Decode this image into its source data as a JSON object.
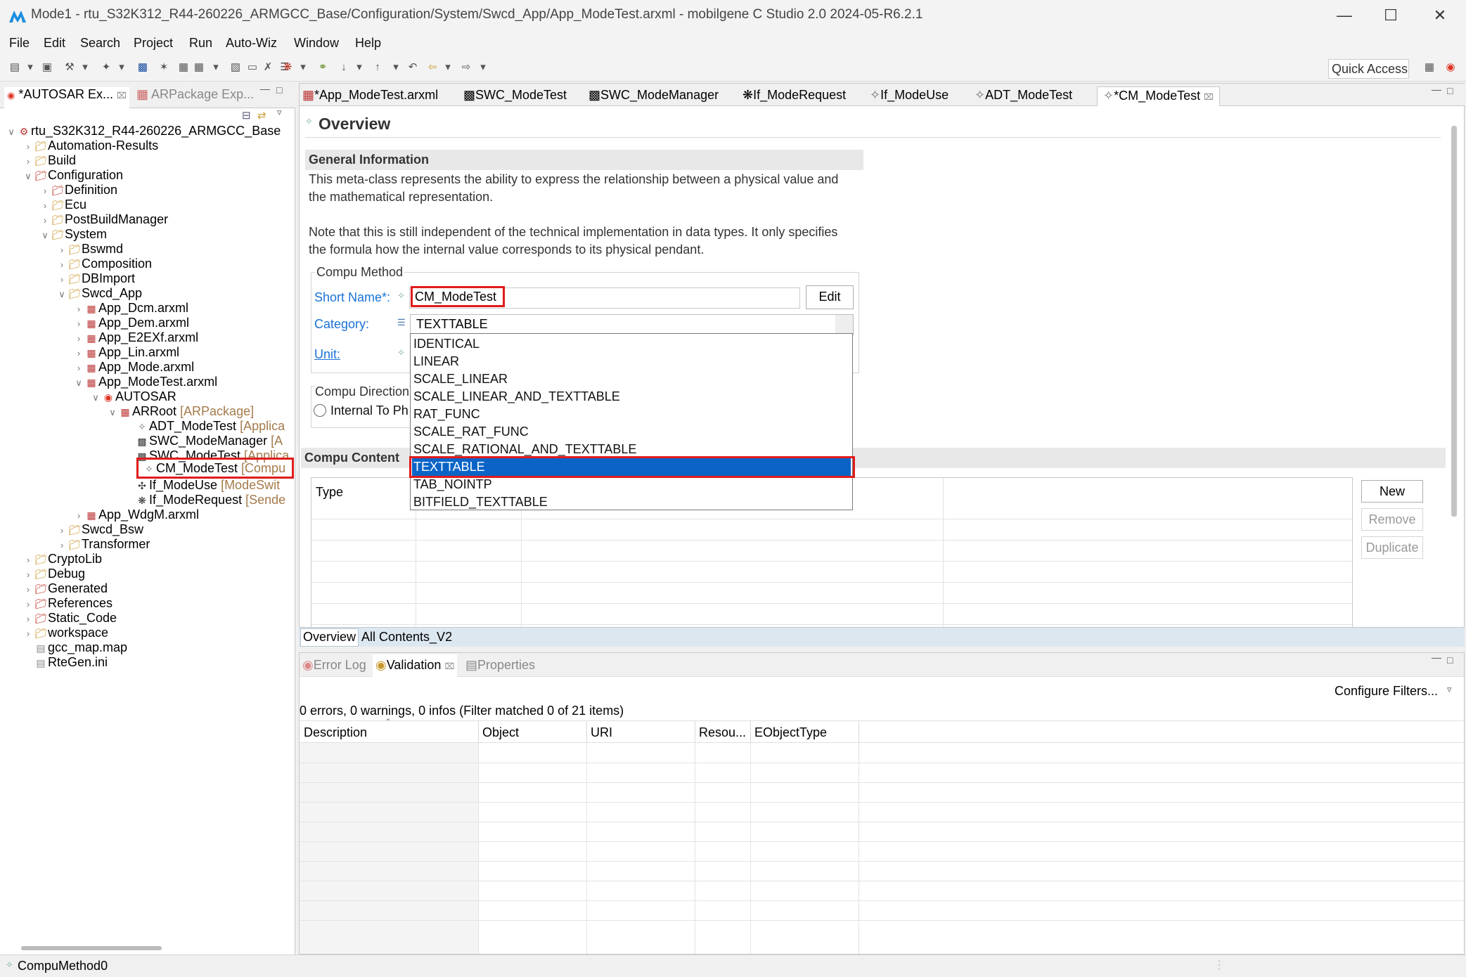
{
  "window": {
    "title": "Mode1 - rtu_S32K312_R44-260226_ARMGCC_Base/Configuration/System/Swcd_App/App_ModeTest.arxml - mobilgene C Studio 2.0 2024-05-R6.2.1"
  },
  "menu": [
    "File",
    "Edit",
    "Search",
    "Project",
    "Run",
    "Auto-Wiz",
    "Window",
    "Help"
  ],
  "toolbar": {
    "quick_access": "Quick Access"
  },
  "left_tabs": [
    "*AUTOSAR Ex...",
    "ARPackage Exp..."
  ],
  "tree": [
    {
      "label": "rtu_S32K312_R44-260226_ARMGCC_Base",
      "suffix": ""
    },
    {
      "label": "Automation-Results",
      "suffix": ""
    },
    {
      "label": "Build",
      "suffix": ""
    },
    {
      "label": "Configuration",
      "suffix": ""
    },
    {
      "label": "Definition",
      "suffix": ""
    },
    {
      "label": "Ecu",
      "suffix": ""
    },
    {
      "label": "PostBuildManager",
      "suffix": ""
    },
    {
      "label": "System",
      "suffix": ""
    },
    {
      "label": "Bswmd",
      "suffix": ""
    },
    {
      "label": "Composition",
      "suffix": ""
    },
    {
      "label": "DBImport",
      "suffix": ""
    },
    {
      "label": "Swcd_App",
      "suffix": ""
    },
    {
      "label": "App_Dcm.arxml",
      "suffix": ""
    },
    {
      "label": "App_Dem.arxml",
      "suffix": ""
    },
    {
      "label": "App_E2EXf.arxml",
      "suffix": ""
    },
    {
      "label": "App_Lin.arxml",
      "suffix": ""
    },
    {
      "label": "App_Mode.arxml",
      "suffix": ""
    },
    {
      "label": "App_ModeTest.arxml",
      "suffix": ""
    },
    {
      "label": "AUTOSAR",
      "suffix": ""
    },
    {
      "label": "ARRoot",
      "suffix": " [ARPackage]"
    },
    {
      "label": "ADT_ModeTest",
      "suffix": " [Applica"
    },
    {
      "label": "SWC_ModeManager",
      "suffix": " [A"
    },
    {
      "label": "SWC_ModeTest",
      "suffix": " [Applica"
    },
    {
      "label": "CM_ModeTest",
      "suffix": " [Compu"
    },
    {
      "label": "If_ModeUse",
      "suffix": " [ModeSwit"
    },
    {
      "label": "If_ModeRequest",
      "suffix": " [Sende"
    },
    {
      "label": "App_WdgM.arxml",
      "suffix": ""
    },
    {
      "label": "Swcd_Bsw",
      "suffix": ""
    },
    {
      "label": "Transformer",
      "suffix": ""
    },
    {
      "label": "CryptoLib",
      "suffix": ""
    },
    {
      "label": "Debug",
      "suffix": ""
    },
    {
      "label": "Generated",
      "suffix": ""
    },
    {
      "label": "References",
      "suffix": ""
    },
    {
      "label": "Static_Code",
      "suffix": ""
    },
    {
      "label": "workspace",
      "suffix": ""
    },
    {
      "label": "gcc_map.map",
      "suffix": ""
    },
    {
      "label": "RteGen.ini",
      "suffix": ""
    }
  ],
  "editor_tabs": [
    "*App_ModeTest.arxml",
    "SWC_ModeTest",
    "SWC_ModeManager",
    "If_ModeRequest",
    "If_ModeUse",
    "ADT_ModeTest",
    "*CM_ModeTest"
  ],
  "overview": {
    "title": "Overview",
    "general_header": "General Information",
    "desc1_line1": "This meta-class represents the ability to express the relationship between a physical value and",
    "desc1_line2": "the mathematical representation.",
    "desc2_line1": "Note that this is still independent of the technical implementation in data types. It only specifies",
    "desc2_line2": "the formula how the internal value corresponds to its physical pendant.",
    "compu_method_group": "Compu Method",
    "short_name_label": "Short Name*:",
    "short_name_value": "CM_ModeTest",
    "edit_button": "Edit",
    "category_label": "Category:",
    "category_value": "TEXTTABLE",
    "unit_label": "Unit:",
    "compu_direction_group": "Compu Direction",
    "direction_option": "Internal To Ph",
    "compu_content_header": "Compu Content",
    "type_column": "Type",
    "new_button": "New",
    "remove_button": "Remove",
    "duplicate_button": "Duplicate"
  },
  "category_options": [
    "IDENTICAL",
    "LINEAR",
    "SCALE_LINEAR",
    "SCALE_LINEAR_AND_TEXTTABLE",
    "RAT_FUNC",
    "SCALE_RAT_FUNC",
    "SCALE_RATIONAL_AND_TEXTTABLE",
    "TEXTTABLE",
    "TAB_NOINTP",
    "BITFIELD_TEXTTABLE"
  ],
  "selected_option_index": 7,
  "editor_bottom_tabs": [
    "Overview",
    "All Contents_V2"
  ],
  "bottom_panel": {
    "tabs": [
      "Error Log",
      "Validation",
      "Properties"
    ],
    "configure_filters": "Configure Filters...",
    "summary": "0 errors, 0 warnings, 0 infos (Filter matched 0 of 21 items)",
    "columns": [
      "Description",
      "Object",
      "URI",
      "Resou...",
      "EObjectType"
    ]
  },
  "status_bar": {
    "text": "CompuMethod0"
  },
  "colors": {
    "highlight_red": "#e01b1b",
    "selection_blue": "#0a64c8",
    "link_blue": "#1a73d6"
  }
}
